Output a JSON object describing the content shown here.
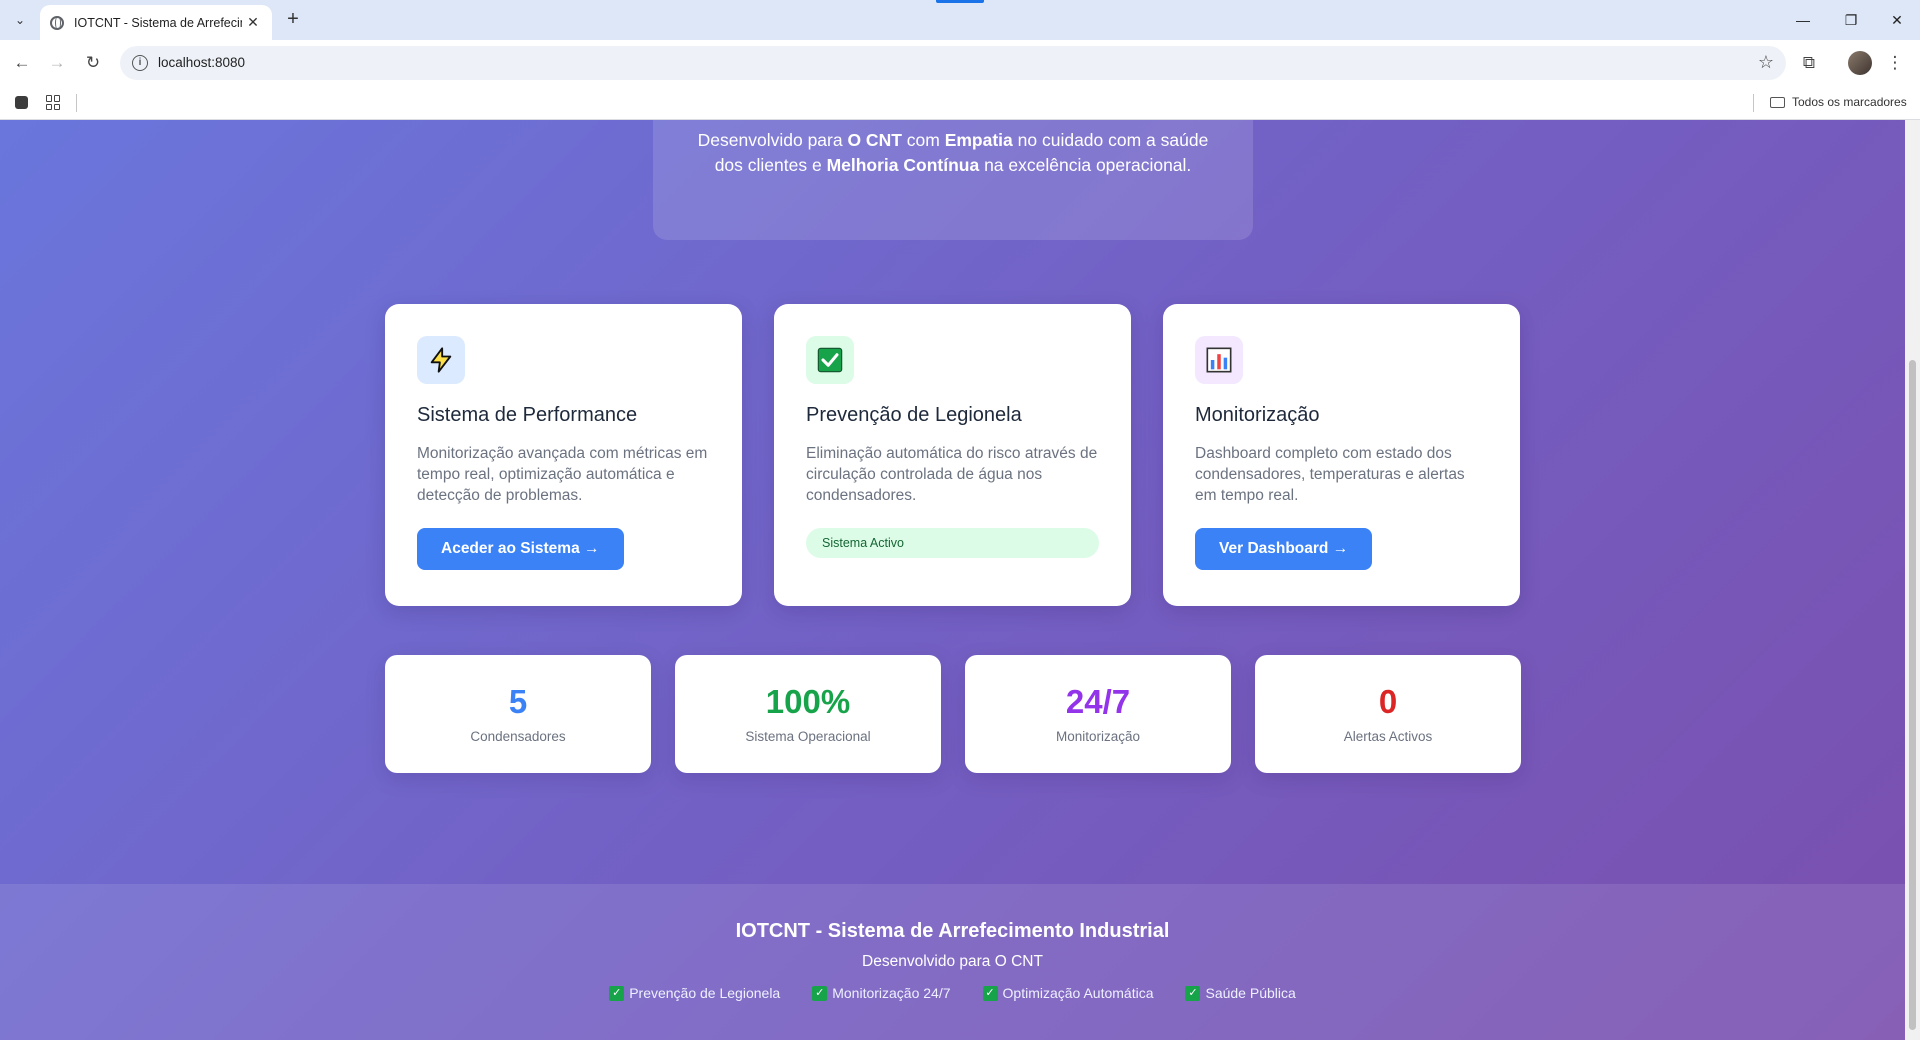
{
  "browser": {
    "tab_title": "IOTCNT - Sistema de Arrefecim",
    "url": "localhost:8080",
    "bookmarks_folder": "Todos os marcadores"
  },
  "hero": {
    "line1_a": "Desenvolvido para ",
    "line1_b": "O CNT",
    "line1_c": " com ",
    "line1_d": "Empatia",
    "line1_e": " no cuidado com a saúde",
    "line2_a": "dos clientes e ",
    "line2_b": "Melhoria Contínua",
    "line2_c": " na excelência operacional."
  },
  "cards": [
    {
      "icon": "lightning-icon",
      "title": "Sistema de Performance",
      "description": "Monitorização avançada com métricas em tempo real, optimização automática e detecção de problemas.",
      "button": "Aceder ao Sistema →"
    },
    {
      "icon": "check-icon",
      "title": "Prevenção de Legionela",
      "description": "Eliminação automática do risco através de circulação controlada de água nos condensadores.",
      "status": "Sistema Activo"
    },
    {
      "icon": "bar-chart-icon",
      "title": "Monitorização",
      "description": "Dashboard completo com estado dos condensadores, temperaturas e alertas em tempo real.",
      "button": "Ver Dashboard →"
    }
  ],
  "stats": [
    {
      "value": "5",
      "label": "Condensadores",
      "color": "#3b82f6"
    },
    {
      "value": "100%",
      "label": "Sistema Operacional",
      "color": "#16a34a"
    },
    {
      "value": "24/7",
      "label": "Monitorização",
      "color": "#9333ea"
    },
    {
      "value": "0",
      "label": "Alertas Activos",
      "color": "#dc2626"
    }
  ],
  "footer": {
    "title": "IOTCNT - Sistema de Arrefecimento Industrial",
    "subtitle": "Desenvolvido para O CNT",
    "features": [
      "Prevenção de Legionela",
      "Monitorização 24/7",
      "Optimização Automática",
      "Saúde Pública"
    ]
  }
}
